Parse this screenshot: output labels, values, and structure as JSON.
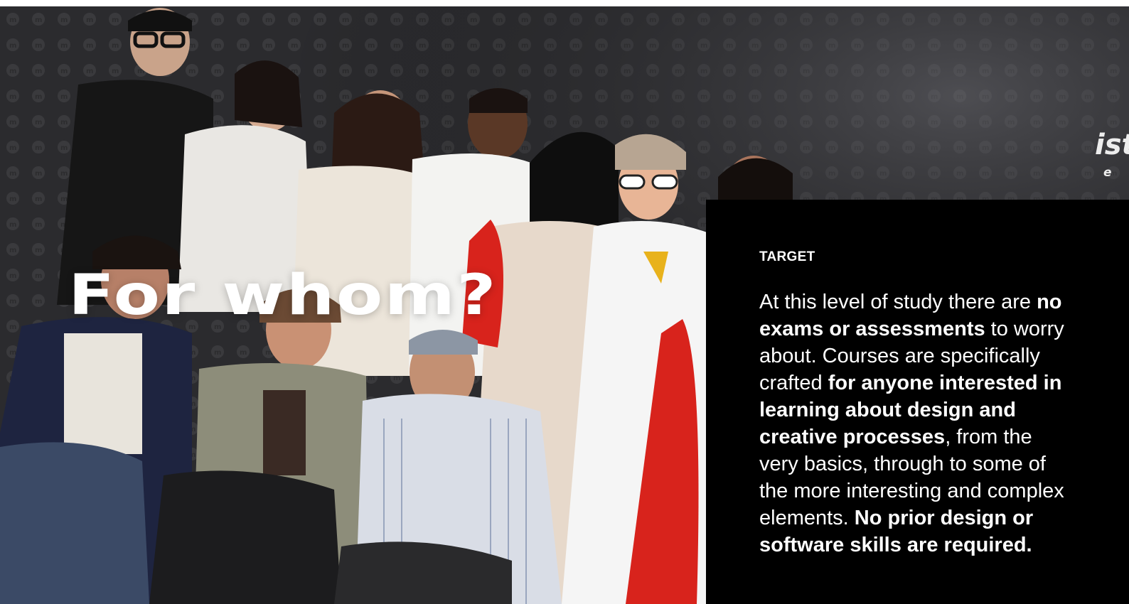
{
  "hero": {
    "title": "For whom?",
    "photo_alt": "Group photo of students posing in front of a patterned dark backdrop",
    "backdrop_text": "istr",
    "backdrop_subtext": "e"
  },
  "panel": {
    "kicker": "TARGET",
    "body_segments": [
      {
        "text": "At this level of study there are ",
        "bold": false
      },
      {
        "text": "no exams or assessments",
        "bold": true
      },
      {
        "text": " to worry about. Courses are specifically crafted ",
        "bold": false
      },
      {
        "text": "for anyone interested in learning about design and creative processes",
        "bold": true
      },
      {
        "text": ", from the very basics, through to some of the more interesting and complex elements. ",
        "bold": false
      },
      {
        "text": "No prior design or software skills are required.",
        "bold": true
      }
    ]
  },
  "colors": {
    "panel_background": "#000000",
    "text": "#ffffff",
    "backdrop": "#2a2a2c",
    "accent_red": "#d8231c"
  }
}
